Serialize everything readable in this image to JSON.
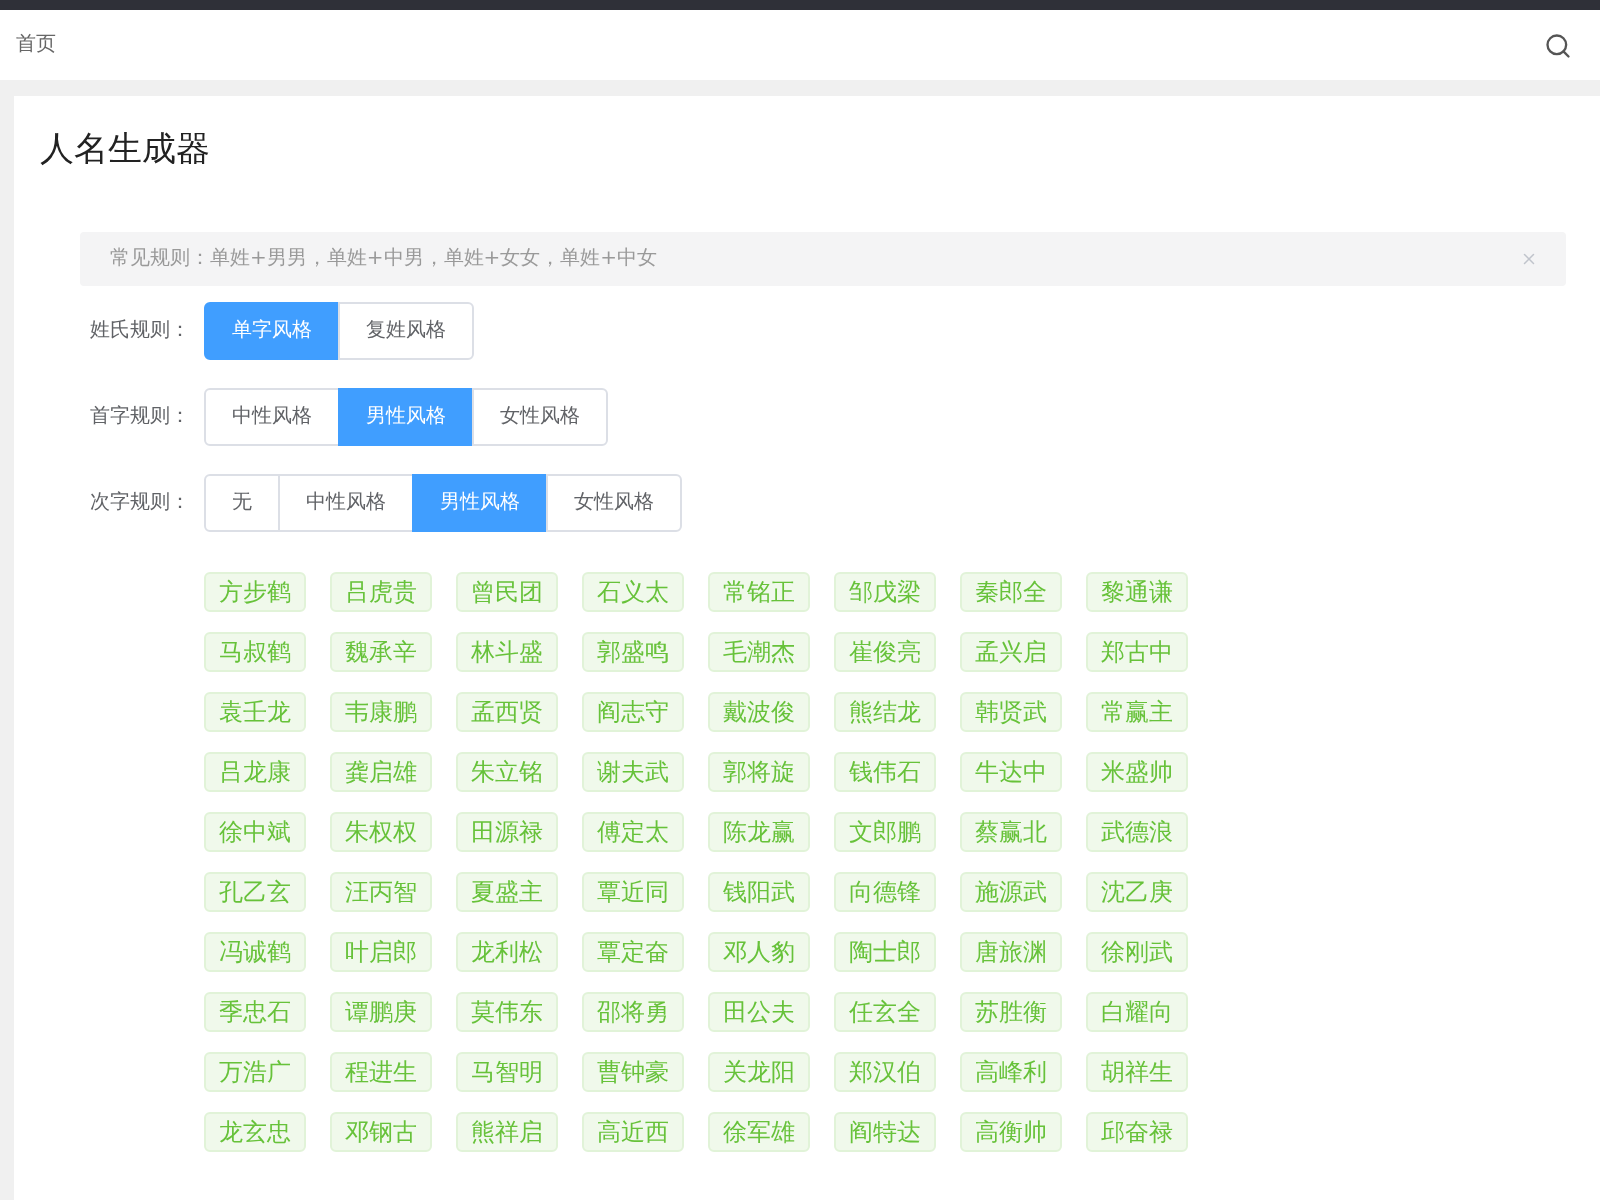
{
  "header": {
    "breadcrumb": "首页"
  },
  "page": {
    "title": "人名生成器"
  },
  "notice": {
    "text": "常见规则：单姓+男男，单姓+中男，单姓+女女，单姓+中女",
    "closable": true
  },
  "rules": [
    {
      "label": "姓氏规则：",
      "options": [
        {
          "label": "单字风格",
          "selected": true
        },
        {
          "label": "复姓风格",
          "selected": false
        }
      ]
    },
    {
      "label": "首字规则：",
      "options": [
        {
          "label": "中性风格",
          "selected": false
        },
        {
          "label": "男性风格",
          "selected": true
        },
        {
          "label": "女性风格",
          "selected": false
        }
      ]
    },
    {
      "label": "次字规则：",
      "options": [
        {
          "label": "无",
          "selected": false
        },
        {
          "label": "中性风格",
          "selected": false
        },
        {
          "label": "男性风格",
          "selected": true
        },
        {
          "label": "女性风格",
          "selected": false
        }
      ]
    }
  ],
  "names": [
    "方步鹤",
    "吕虎贵",
    "曾民团",
    "石义太",
    "常铭正",
    "邹戊梁",
    "秦郎全",
    "黎通谦",
    "马叔鹤",
    "魏承辛",
    "林斗盛",
    "郭盛鸣",
    "毛潮杰",
    "崔俊亮",
    "孟兴启",
    "郑古中",
    "袁壬龙",
    "韦康鹏",
    "孟西贤",
    "阎志守",
    "戴波俊",
    "熊结龙",
    "韩贤武",
    "常赢主",
    "吕龙康",
    "龚启雄",
    "朱立铭",
    "谢夫武",
    "郭将旋",
    "钱伟石",
    "牛达中",
    "米盛帅",
    "徐中斌",
    "朱权权",
    "田源禄",
    "傅定太",
    "陈龙赢",
    "文郎鹏",
    "蔡赢北",
    "武德浪",
    "孔乙玄",
    "汪丙智",
    "夏盛主",
    "覃近同",
    "钱阳武",
    "向德锋",
    "施源武",
    "沈乙庚",
    "冯诚鹤",
    "叶启郎",
    "龙利松",
    "覃定奋",
    "邓人豹",
    "陶士郎",
    "唐旅渊",
    "徐刚武",
    "季忠石",
    "谭鹏庚",
    "莫伟东",
    "邵将勇",
    "田公夫",
    "任玄全",
    "苏胜衡",
    "白耀向",
    "万浩广",
    "程进生",
    "马智明",
    "曹钟豪",
    "关龙阳",
    "郑汉伯",
    "高峰利",
    "胡祥生",
    "龙玄忠",
    "邓钢古",
    "熊祥启",
    "高近西",
    "徐军雄",
    "阎特达",
    "高衡帅",
    "邱奋禄"
  ]
}
